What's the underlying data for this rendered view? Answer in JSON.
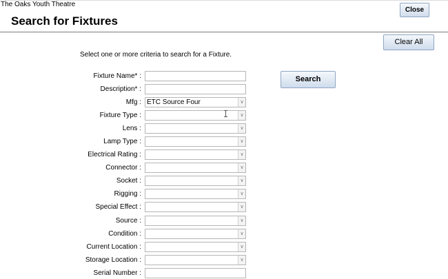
{
  "app": {
    "org_name": "The Oaks Youth Theatre",
    "title": "Search for Fixtures"
  },
  "buttons": {
    "close": "Close",
    "clear_all": "Clear All",
    "search": "Search"
  },
  "instructions": "Select one or more criteria to search for a Fixture.",
  "fields": [
    {
      "label": "Fixture Name* :",
      "type": "text",
      "value": ""
    },
    {
      "label": "Description* :",
      "type": "text",
      "value": ""
    },
    {
      "label": "Mfg :",
      "type": "select",
      "value": "ETC Source Four"
    },
    {
      "label": "Fixture Type :",
      "type": "select",
      "value": ""
    },
    {
      "label": "Lens :",
      "type": "select",
      "value": ""
    },
    {
      "label": "Lamp Type :",
      "type": "select",
      "value": ""
    },
    {
      "label": "Electrical Rating :",
      "type": "select",
      "value": ""
    },
    {
      "label": "Connector :",
      "type": "select",
      "value": ""
    },
    {
      "label": "Socket :",
      "type": "select",
      "value": ""
    },
    {
      "label": "Rigging :",
      "type": "select",
      "value": ""
    },
    {
      "label": "Special Effect :",
      "type": "select",
      "value": ""
    },
    {
      "label": "Source :",
      "type": "select",
      "value": ""
    },
    {
      "label": "Condition :",
      "type": "select",
      "value": ""
    },
    {
      "label": "Current Location :",
      "type": "select",
      "value": ""
    },
    {
      "label": "Storage Location :",
      "type": "select",
      "value": ""
    },
    {
      "label": "Serial Number :",
      "type": "text",
      "value": ""
    }
  ],
  "colors": {
    "button_border": "#8ea6c2",
    "button_top": "#f4f8fc",
    "button_bottom": "#cfdcec"
  },
  "icons": {
    "dropdown": "chevron-down-icon",
    "cursor": "text-cursor-icon"
  }
}
